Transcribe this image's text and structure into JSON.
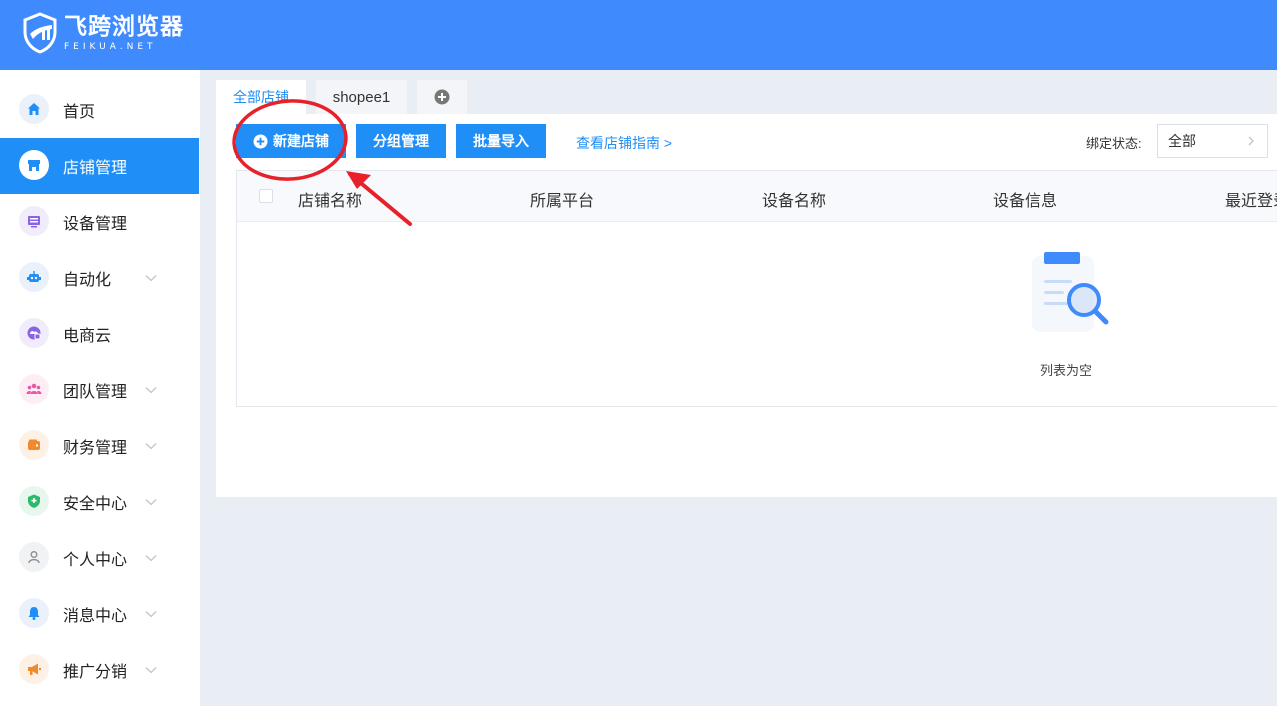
{
  "app": {
    "logo_title": "飞跨浏览器",
    "logo_subtitle": "FEIKUA.NET"
  },
  "sidebar": {
    "items": [
      {
        "label": "首页",
        "icon": "home-icon",
        "color": "#1f8ef7",
        "bg": "#eaf1fb",
        "expandable": false,
        "active": false
      },
      {
        "label": "店铺管理",
        "icon": "store-icon",
        "color": "#1f8ef7",
        "bg": "#ffffff",
        "expandable": false,
        "active": true
      },
      {
        "label": "设备管理",
        "icon": "device-icon",
        "color": "#8a62e6",
        "bg": "#f1ecfb",
        "expandable": false,
        "active": false
      },
      {
        "label": "自动化",
        "icon": "robot-icon",
        "color": "#1f8ef7",
        "bg": "#eaf1fb",
        "expandable": true,
        "active": false
      },
      {
        "label": "电商云",
        "icon": "cloud-icon",
        "color": "#8a62e6",
        "bg": "#f1ecfb",
        "expandable": false,
        "active": false
      },
      {
        "label": "团队管理",
        "icon": "team-icon",
        "color": "#e85aa8",
        "bg": "#fdeef6",
        "expandable": true,
        "active": false
      },
      {
        "label": "财务管理",
        "icon": "wallet-icon",
        "color": "#f08a2c",
        "bg": "#fdf1e6",
        "expandable": true,
        "active": false
      },
      {
        "label": "安全中心",
        "icon": "shield-icon",
        "color": "#2dbb6b",
        "bg": "#e8f7ee",
        "expandable": true,
        "active": false
      },
      {
        "label": "个人中心",
        "icon": "user-icon",
        "color": "#8c8f96",
        "bg": "#f1f2f4",
        "expandable": true,
        "active": false
      },
      {
        "label": "消息中心",
        "icon": "bell-icon",
        "color": "#1f8ef7",
        "bg": "#eaf1fb",
        "expandable": true,
        "active": false
      },
      {
        "label": "推广分销",
        "icon": "megaphone-icon",
        "color": "#f08a2c",
        "bg": "#fdf1e6",
        "expandable": true,
        "active": false
      }
    ]
  },
  "tabs": [
    {
      "label": "全部店铺",
      "active": true
    },
    {
      "label": "shopee1",
      "active": false
    },
    {
      "label": "add-tab-icon",
      "active": false
    }
  ],
  "toolbar": {
    "new_store": "新建店铺",
    "group_manage": "分组管理",
    "batch_import": "批量导入",
    "guide_link": "查看店铺指南 >",
    "bind_status_label": "绑定状态:",
    "bind_status_value": "全部"
  },
  "table": {
    "columns": [
      "店铺名称",
      "所属平台",
      "设备名称",
      "设备信息",
      "最近登录"
    ],
    "rows": [],
    "empty_text": "列表为空"
  },
  "colors": {
    "header": "#3f8bfd",
    "primary": "#1f8ef7",
    "annotation": "#e8202a"
  }
}
